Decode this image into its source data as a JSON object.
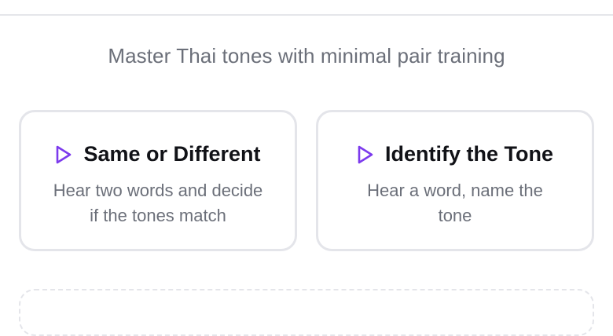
{
  "header": {
    "subtitle": "Master Thai tones with minimal pair training"
  },
  "modes": [
    {
      "title": "Same or Different",
      "description": "Hear two words and decide if the tones match",
      "icon": "play-icon"
    },
    {
      "title": "Identify the Tone",
      "description": "Hear a word, name the tone",
      "icon": "play-icon"
    }
  ],
  "colors": {
    "accent": "#7c3aed",
    "text_primary": "#111217",
    "text_secondary": "#6b6f79",
    "border": "#e4e5ea"
  }
}
